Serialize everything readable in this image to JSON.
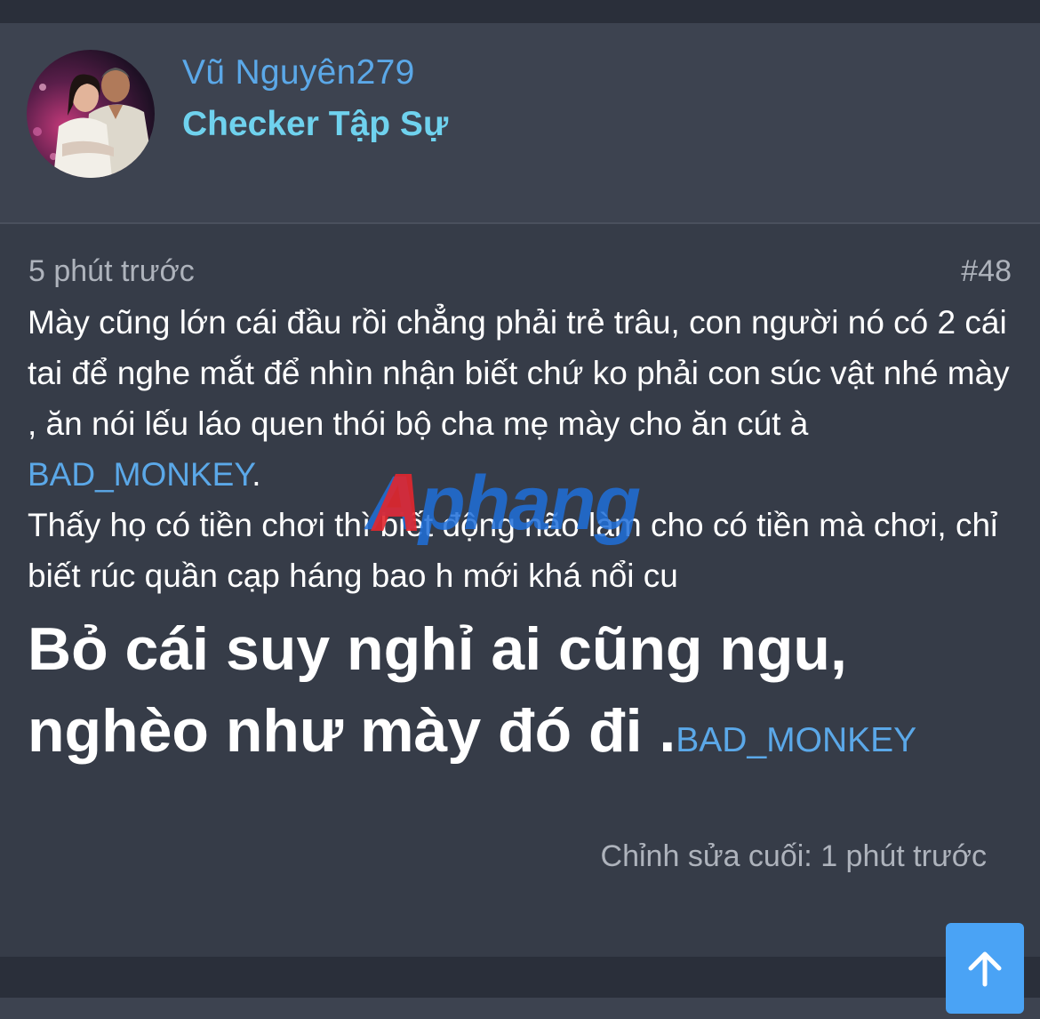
{
  "user": {
    "name": "Vũ Nguyên279",
    "title": "Checker Tập Sự"
  },
  "post": {
    "time": "5 phút trước",
    "number": "#48",
    "paragraph1_text": "Mày cũng lớn cái đầu rồi chẳng phải trẻ trâu, con người nó có 2 cái tai để nghe mắt để nhìn nhận biết chứ ko phải con súc vật nhé mày , ăn nói lếu láo quen thói bộ cha mẹ mày cho ăn cút à ",
    "paragraph1_mention": "BAD_MONKEY",
    "paragraph1_end": ".",
    "paragraph2_text": "Thấy họ có tiền chơi thì biết động não làm cho có tiền mà chơi, chỉ biết rúc quần cạp háng bao h mới khá nổi cu",
    "big_text": "Bỏ cái suy nghỉ ai cũng ngu, nghèo như mày đó đi .",
    "big_mention": "BAD_MONKEY",
    "edited": "Chỉnh sửa cuối: 1 phút trước"
  },
  "watermark": "Aphang",
  "icons": {
    "scroll_top": "arrow-up-icon"
  },
  "colors": {
    "page_bg": "#2a2f3a",
    "post_bg": "#363c48",
    "header_bg": "#3d4350",
    "username": "#5ba8e8",
    "user_title": "#6fd2ee",
    "mention": "#5ba8e8",
    "button": "#4aa3f5"
  }
}
